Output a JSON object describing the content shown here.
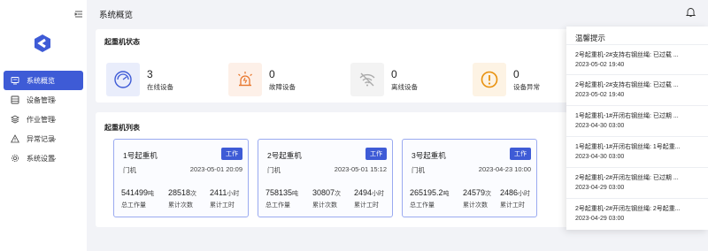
{
  "header": {
    "title": "系统概览"
  },
  "sidebar": {
    "items": [
      {
        "label": "系统概览",
        "icon": "monitor-icon",
        "active": true
      },
      {
        "label": "设备管理",
        "icon": "database-icon"
      },
      {
        "label": "作业管理",
        "icon": "layers-icon"
      },
      {
        "label": "异常记录",
        "icon": "warning-icon"
      },
      {
        "label": "系统设置",
        "icon": "gear-icon"
      }
    ]
  },
  "status": {
    "title": "起重机状态",
    "items": [
      {
        "value": "3",
        "label": "在线设备",
        "icon": "gauge-icon",
        "color": "#3e5bd6"
      },
      {
        "value": "0",
        "label": "故障设备",
        "icon": "alarm-light-icon",
        "color": "#e8762c"
      },
      {
        "value": "0",
        "label": "离线设备",
        "icon": "wifi-off-icon",
        "color": "#999999"
      },
      {
        "value": "0",
        "label": "设备异常",
        "icon": "exclamation-circle-icon",
        "color": "#e8900c"
      }
    ]
  },
  "cranes": {
    "title": "起重机列表",
    "items": [
      {
        "name": "1号起重机",
        "badge": "工作",
        "type": "门机",
        "time": "2023-05-01 20:09",
        "load": "541499",
        "load_unit": "吨",
        "load_label": "总工作量",
        "count": "28518",
        "count_unit": "次",
        "count_label": "累计次数",
        "hours": "2411",
        "hours_unit": "小时",
        "hours_label": "累计工时"
      },
      {
        "name": "2号起重机",
        "badge": "工作",
        "type": "门机",
        "time": "2023-05-01 15:12",
        "load": "758135",
        "load_unit": "吨",
        "load_label": "总工作量",
        "count": "30807",
        "count_unit": "次",
        "count_label": "累计次数",
        "hours": "2494",
        "hours_unit": "小时",
        "hours_label": "累计工时"
      },
      {
        "name": "3号起重机",
        "badge": "工作",
        "type": "门机",
        "time": "2023-04-23 10:00",
        "load": "265195.2",
        "load_unit": "吨",
        "load_label": "总工作量",
        "count": "24579",
        "count_unit": "次",
        "count_label": "累计次数",
        "hours": "2486",
        "hours_unit": "小时",
        "hours_label": "累计工时"
      }
    ]
  },
  "notices": {
    "title": "温馨提示",
    "items": [
      {
        "text": "2号起重机-2#支持右钢丝绳: 已过载 ...",
        "time": "2023-05-02 19:40"
      },
      {
        "text": "2号起重机-2#支持右钢丝绳: 已过载 ...",
        "time": "2023-05-02 19:40"
      },
      {
        "text": "1号起重机-1#开闭右钢丝绳: 已过期 ...",
        "time": "2023-04-30 03:00"
      },
      {
        "text": "1号起重机-1#开闭右钢丝绳: 1号起重...",
        "time": "2023-04-30 03:00"
      },
      {
        "text": "2号起重机-2#开闭左钢丝绳: 已过期 ...",
        "time": "2023-04-29 03:00"
      },
      {
        "text": "2号起重机-2#开闭左钢丝绳: 2号起重...",
        "time": "2023-04-29 03:00"
      }
    ]
  }
}
